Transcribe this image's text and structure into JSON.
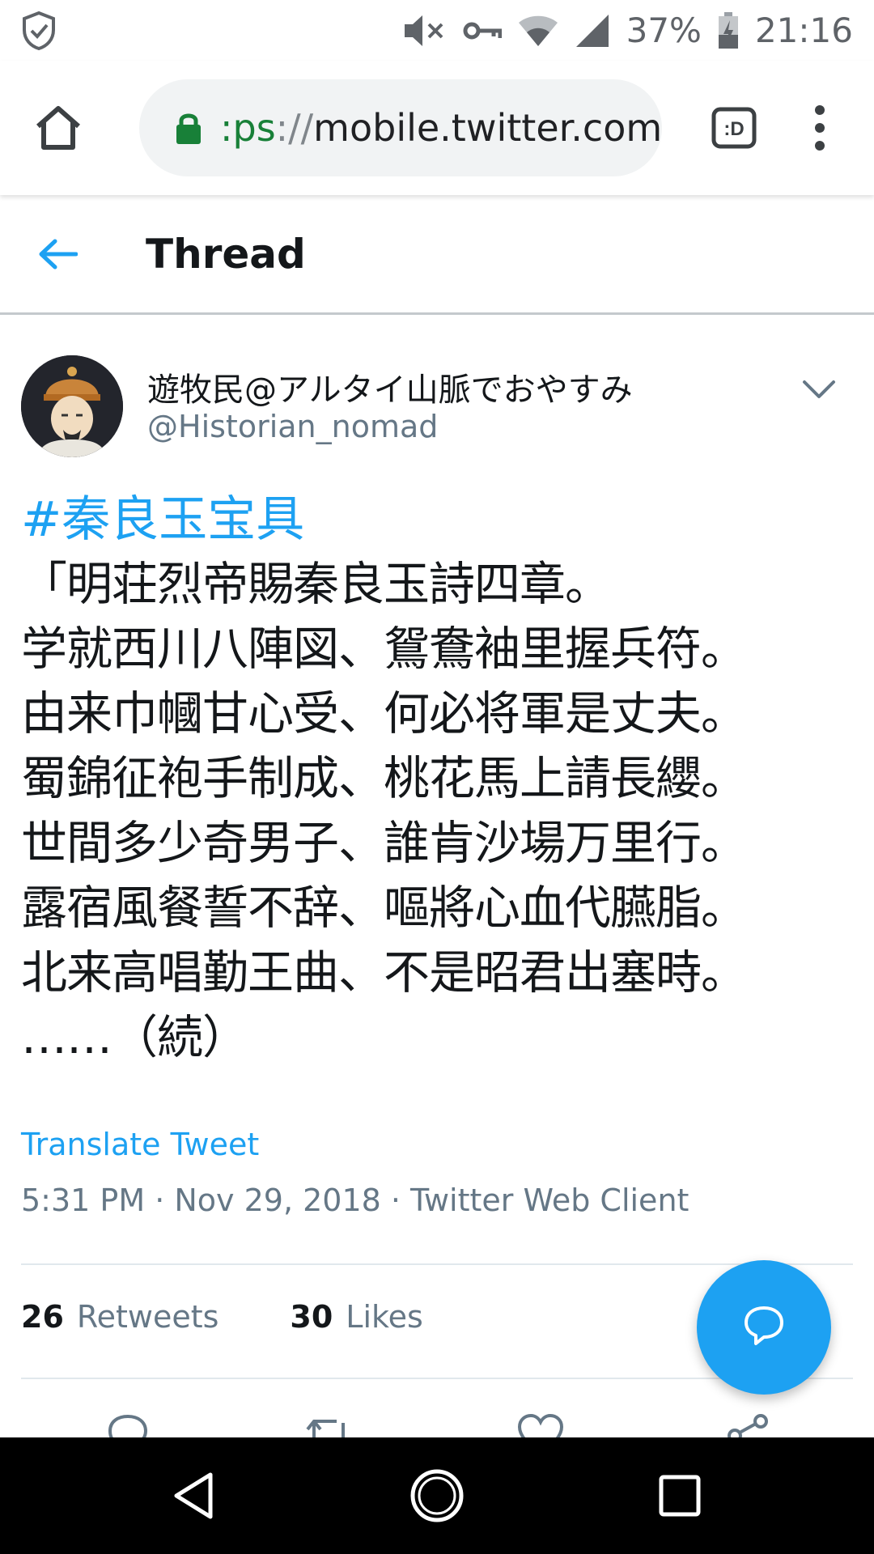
{
  "status_bar": {
    "battery_percent": "37%",
    "time": "21:16",
    "icons": [
      "shield-check-icon",
      "mute-icon",
      "vpn-key-icon",
      "wifi-icon",
      "cell-signal-icon",
      "battery-charging-icon"
    ]
  },
  "browser": {
    "url_scheme": ":ps",
    "url_separator": "://",
    "url_host": "mobile.twitter.com",
    "tabs_icon_label": ":D",
    "icons": [
      "home-icon",
      "lock-icon",
      "tab-switcher-icon",
      "more-vert-icon"
    ]
  },
  "header": {
    "title": "Thread",
    "back_icon": "arrow-left-icon"
  },
  "tweet": {
    "author_name": "遊牧民@アルタイ山脈でおやすみ",
    "author_handle": "@Historian_nomad",
    "hashtag": "#秦良玉宝具",
    "lines": [
      "「明荘烈帝賜秦良玉詩四章。",
      "学就西川八陣図、鴛鴦袖里握兵符。",
      "由来巾幗甘心受、何必将軍是丈夫。",
      "蜀錦征袍手制成、桃花馬上請長纓。",
      "世間多少奇男子、誰肯沙場万里行。",
      "露宿風餐誓不辞、嘔將心血代臙脂。",
      "北来高唱勤王曲、不是昭君出塞時。",
      "……（続）"
    ],
    "translate_label": "Translate Tweet",
    "timestamp": "5:31 PM · Nov 29, 2018 · Twitter Web Client",
    "stats": {
      "retweets_count": "26",
      "retweets_label": "Retweets",
      "likes_count": "30",
      "likes_label": "Likes"
    },
    "action_icons": [
      "reply-icon",
      "retweet-icon",
      "like-icon",
      "share-icon"
    ]
  },
  "fab": {
    "icon": "compose-reply-icon"
  },
  "nav_bar": {
    "icons": [
      "back-triangle-icon",
      "home-circle-icon",
      "recents-square-icon"
    ]
  },
  "colors": {
    "twitter_blue": "#1da1f2",
    "text_primary": "#14171a",
    "text_secondary": "#657786",
    "lock_green": "#188038"
  }
}
